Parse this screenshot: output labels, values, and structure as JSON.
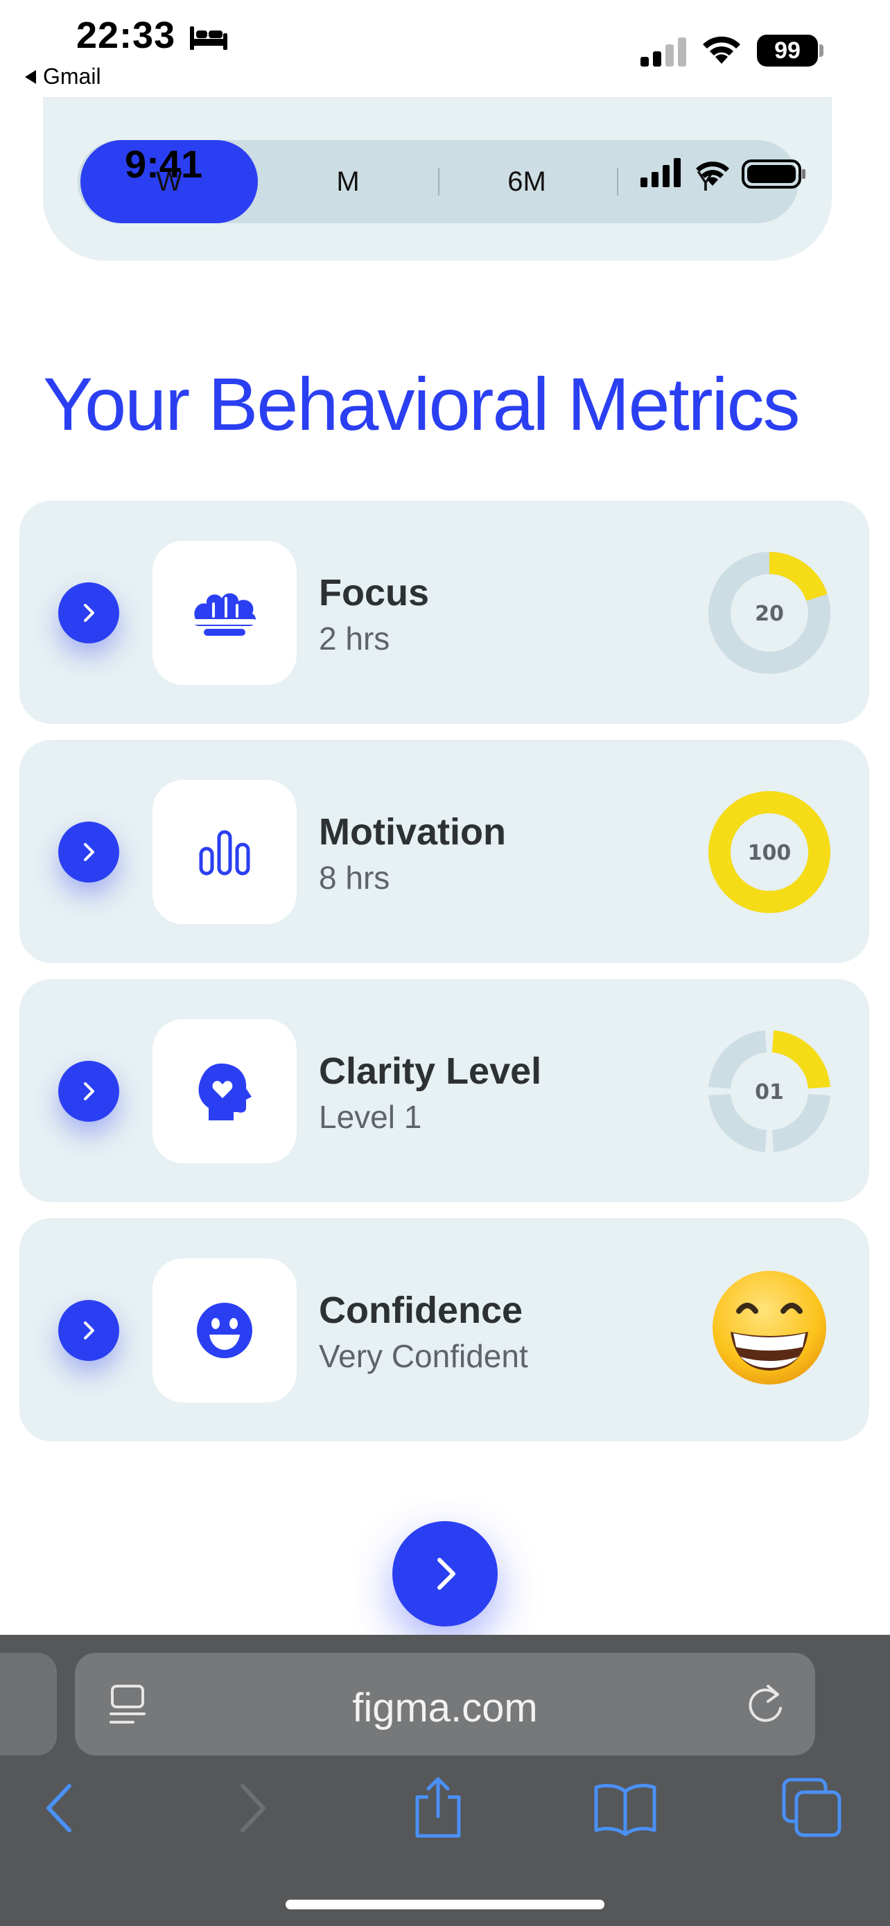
{
  "status_bar": {
    "time": "22:33",
    "back_app": "Gmail",
    "battery": "99"
  },
  "period_tabs": {
    "overlay_time": "9:41",
    "tabs": [
      {
        "label": "W",
        "active": true
      },
      {
        "label": "M",
        "active": false
      },
      {
        "label": "6M",
        "active": false
      },
      {
        "label": "Y",
        "active": false
      }
    ]
  },
  "heading": "Your Behavioral Metrics",
  "metrics": [
    {
      "title": "Focus",
      "subtitle": "2 hrs",
      "icon": "brain-icon",
      "value_label": "20",
      "progress": 0.2,
      "segmented": false
    },
    {
      "title": "Motivation",
      "subtitle": "8 hrs",
      "icon": "bar-chart-icon",
      "value_label": "100",
      "progress": 1.0,
      "segmented": false
    },
    {
      "title": "Clarity Level",
      "subtitle": "Level 1",
      "icon": "head-heart-icon",
      "value_label": "01",
      "progress": 0.25,
      "segmented": true
    },
    {
      "title": "Confidence",
      "subtitle": "Very Confident",
      "icon": "smiley-icon",
      "emoji": "grinning-face-emoji"
    }
  ],
  "browser": {
    "url": "figma.com"
  },
  "colors": {
    "accent": "#2b3ff2",
    "ring_fill": "#f5dc16",
    "ring_track": "#ccdde3",
    "card_bg": "#e7f0f3"
  }
}
